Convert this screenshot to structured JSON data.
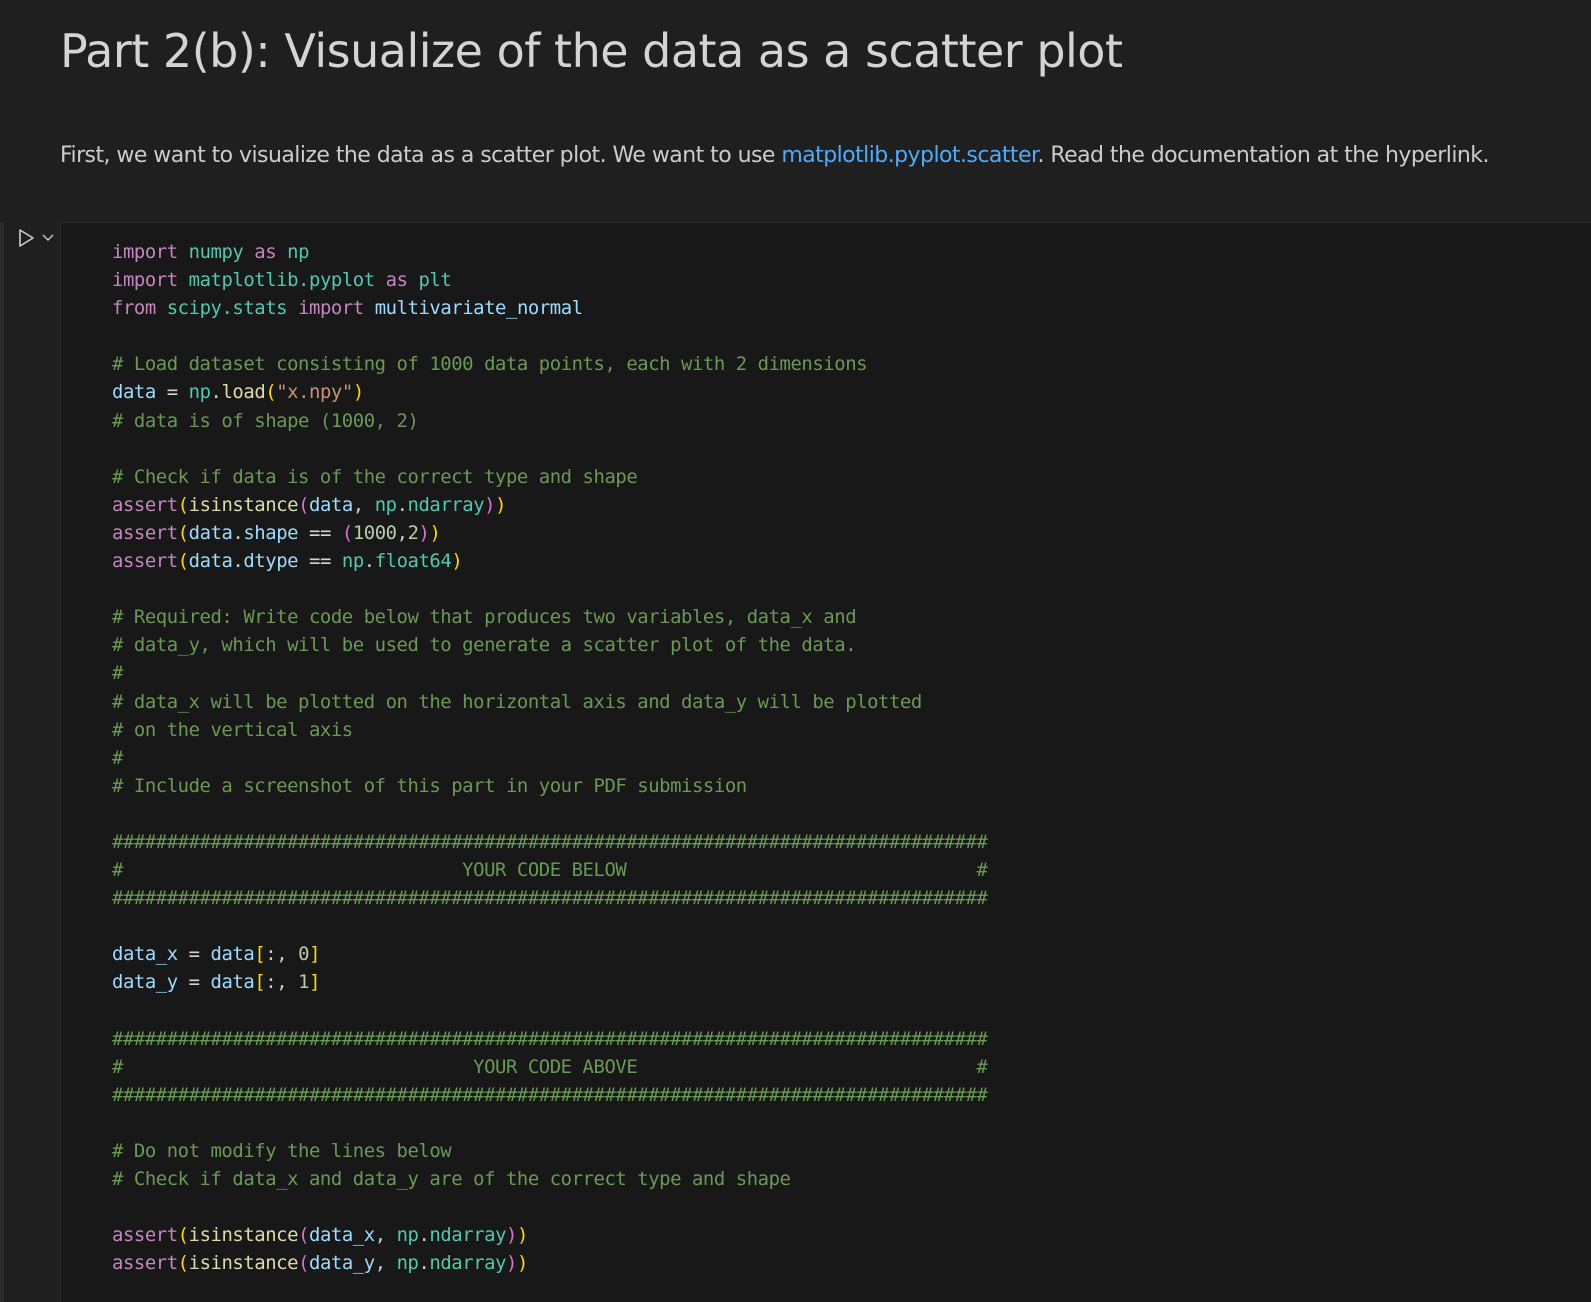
{
  "markdown": {
    "title": "Part 2(b): Visualize of the data as a scatter plot",
    "para_before": "First, we want to visualize the data as a scatter plot. We want to use ",
    "link": "matplotlib.pyplot.scatter",
    "para_after": ". Read the documentation at the hyperlink."
  },
  "toolbar": {
    "run_icon": "run-cell-icon",
    "chevron_icon": "chevron-down-icon"
  },
  "code": {
    "kw_import": "import",
    "kw_from": "from",
    "kw_as": "as",
    "kw_assert": "assert",
    "mod_numpy": "numpy",
    "mod_np": "np",
    "mod_matplotlib": "matplotlib.pyplot",
    "mod_plt": "plt",
    "mod_scipy": "scipy.stats",
    "mod_ndarray": "ndarray",
    "mod_float64": "float64",
    "fn_multivariate": "multivariate_normal",
    "fn_load": "load",
    "fn_isinstance": "isinstance",
    "var_data": "data",
    "var_shape": "shape",
    "var_dtype": "dtype",
    "var_data_x": "data_x",
    "var_data_y": "data_y",
    "str_file": "\"x.npy\"",
    "num_1000": "1000",
    "num_2": "2",
    "num_0": "0",
    "num_1": "1",
    "op_eq": "==",
    "cmt_load": "# Load dataset consisting of 1000 data points, each with 2 dimensions",
    "cmt_shape": "# data is of shape (1000, 2)",
    "cmt_check": "# Check if data is of the correct type and shape",
    "cmt_req1": "# Required: Write code below that produces two variables, data_x and",
    "cmt_req2": "# data_y, which will be used to generate a scatter plot of the data.",
    "cmt_hash": "#",
    "cmt_req3": "# data_x will be plotted on the horizontal axis and data_y will be plotted",
    "cmt_req4": "# on the vertical axis",
    "cmt_req5": "# Include a screenshot of this part in your PDF submission",
    "cmt_bar": "################################################################################",
    "cmt_below": "#                               YOUR CODE BELOW                                #",
    "cmt_above": "#                                YOUR CODE ABOVE                               #",
    "cmt_nomod": "# Do not modify the lines below",
    "cmt_check_xy": "# Check if data_x and data_y are of the correct type and shape"
  }
}
